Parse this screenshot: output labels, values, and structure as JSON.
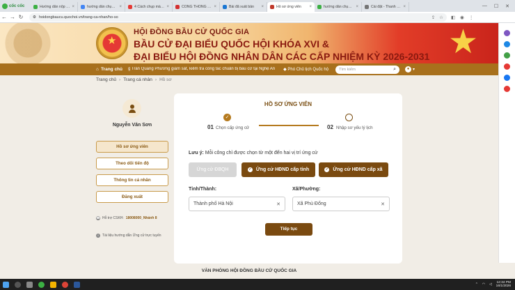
{
  "browser": {
    "brand": "cốc cốc",
    "tabs": [
      {
        "label": "Hướng dẫn nộp hồ sơ và",
        "color": "#3cb043",
        "active": false
      },
      {
        "label": "hướng dẫn chụp màn hình",
        "color": "#4285f4",
        "active": false
      },
      {
        "label": "4 Cách chụp màn hình m",
        "color": "#e53935",
        "active": false
      },
      {
        "label": "CỔNG THÔNG TIN ĐIỆN",
        "color": "#d32f2f",
        "active": false
      },
      {
        "label": "Bài đã xuất bản",
        "color": "#1976d2",
        "active": false
      },
      {
        "label": "Hồ sơ ứng viên",
        "color": "#c0392b",
        "active": true
      },
      {
        "label": "hướng dẫn chụp màn hình",
        "color": "#3cb043",
        "active": false
      },
      {
        "label": "Cài đặt - Thanh tiến",
        "color": "#757575",
        "active": false
      }
    ],
    "url": "hoidongbaucu.quochoi.vn/trang-ca-nhan/ho-so"
  },
  "banner": {
    "line1": "HỘI ĐỒNG BẦU CỬ QUỐC GIA",
    "line2": "BẦU CỬ ĐẠI BIỂU QUỐC HỘI KHÓA XVI &",
    "line3": "ĐẠI BIỂU HỘI ĐỒNG NHÂN DÂN CÁC CẤP NHIỆM KỲ 2026-2031"
  },
  "nav": {
    "home": "Trang chủ",
    "ticker1": "g Trần Quang Phương giám sát, kiểm tra công tác chuẩn bị bầu cử tại Nghệ An",
    "ticker2": "Phó Chủ tịch Quốc hộ",
    "search_placeholder": "Tìm kiếm"
  },
  "breadcrumb": {
    "home": "Trang chủ",
    "profile": "Trang cá nhân",
    "current": "Hồ sơ"
  },
  "sidebar": {
    "user_name": "Nguyễn Văn Sơn",
    "items": [
      {
        "label": "Hồ sơ ứng viên",
        "active": true
      },
      {
        "label": "Theo dõi tiến độ",
        "active": false
      },
      {
        "label": "Thông tin cá nhân",
        "active": false
      },
      {
        "label": "Đăng xuất",
        "active": false
      }
    ],
    "hotline_label": "Hỗ trợ CSKH:",
    "hotline_value": "18008000_Nhánh 8",
    "guide": "Tài liệu hướng dẫn Ứng cử trực tuyến"
  },
  "form": {
    "title": "HỒ SƠ ỨNG VIÊN",
    "step1_num": "01",
    "step1_label": "Chọn cấp ứng cử",
    "step2_num": "02",
    "step2_label": "Nhập sơ yếu lý lịch",
    "note_prefix": "Lưu ý:",
    "note_text": "Mỗi công chỉ được chọn từ một đến hai vị trí ứng cử",
    "options": {
      "dbqh": "Ứng cử ĐBQH",
      "tinh": "Ứng cử HĐND cấp tỉnh",
      "xa": "Ứng cử HĐND cấp xã"
    },
    "province_label": "Tỉnh/Thành:",
    "province_value": "Thành phố Hà Nội",
    "ward_label": "Xã/Phường:",
    "ward_value": "Xã Phù Đổng",
    "submit": "Tiếp tục"
  },
  "footer": "VĂN PHÒNG HỘI ĐỒNG BẦU CỬ QUỐC GIA",
  "taskbar": {
    "time": "12:34 PM",
    "date": "16/1/2026"
  }
}
